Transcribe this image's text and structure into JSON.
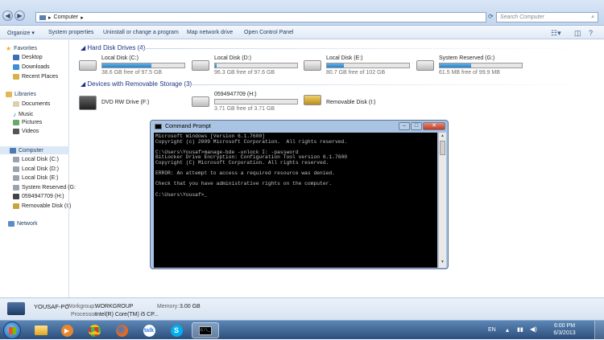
{
  "address": {
    "crumb": "Computer",
    "search_placeholder": "Search Computer"
  },
  "toolbar": {
    "organize": "Organize ▾",
    "system_properties": "System properties",
    "uninstall": "Uninstall or change a program",
    "map_drive": "Map network drive",
    "control_panel": "Open Control Panel"
  },
  "sidebar": {
    "favorites": "Favorites",
    "desktop": "Desktop",
    "downloads": "Downloads",
    "recent": "Recent Places",
    "libraries": "Libraries",
    "documents": "Documents",
    "music": "Music",
    "pictures": "Pictures",
    "videos": "Videos",
    "computer": "Computer",
    "c": "Local Disk (C:)",
    "d": "Local Disk (D:)",
    "e": "Local Disk (E:)",
    "g": "System Reserved (G:",
    "h": "0594947709 (H:)",
    "i": "Removable Disk (I:)",
    "network": "Network"
  },
  "hard_disks": {
    "heading": "Hard Disk Drives (4)",
    "drives": [
      {
        "name": "Local Disk (C:)",
        "free": "38.6 GB free of 97.5 GB",
        "used_fraction": 0.6
      },
      {
        "name": "Local Disk (D:)",
        "free": "96.3 GB free of 97.6 GB",
        "used_fraction": 0.02
      },
      {
        "name": "Local Disk (E:)",
        "free": "80.7 GB free of 102 GB",
        "used_fraction": 0.21
      },
      {
        "name": "System Reserved (G:)",
        "free": "61.5 MB free of 99.9 MB",
        "used_fraction": 0.38
      }
    ]
  },
  "removable": {
    "heading": "Devices with Removable Storage (3)",
    "dvd": "DVD RW Drive (F:)",
    "h_name": "0594947709 (H:)",
    "h_free": "3.71 GB free of 3.71 GB",
    "i_name": "Removable Disk (I:)"
  },
  "details": {
    "pc_name": "YOUSAF-PC",
    "workgroup_label": "Workgroup:",
    "workgroup": "WORKGROUP",
    "memory_label": "Memory:",
    "memory": "3.00 GB",
    "processor_label": "Processor:",
    "processor": "Intel(R) Core(TM) i5 CP..."
  },
  "cmd": {
    "title": "Command Prompt",
    "text": "Microsoft Windows [Version 6.1.7600]\nCopyright (c) 2009 Microsoft Corporation.  All rights reserved.\n\nC:\\Users\\Yousaf>manage-bde -unlock I: -password\nBitLocker Drive Encryption: Configuration Tool version 6.1.7600\nCopyright (C) Microsoft Corporation. All rights reserved.\n\nERROR: An attempt to access a required resource was denied.\n\nCheck that you have administrative rights on the computer.\n\nC:\\Users\\Yousaf>_"
  },
  "taskbar": {
    "lang": "EN",
    "time": "6:00 PM",
    "date": "6/3/2013"
  }
}
